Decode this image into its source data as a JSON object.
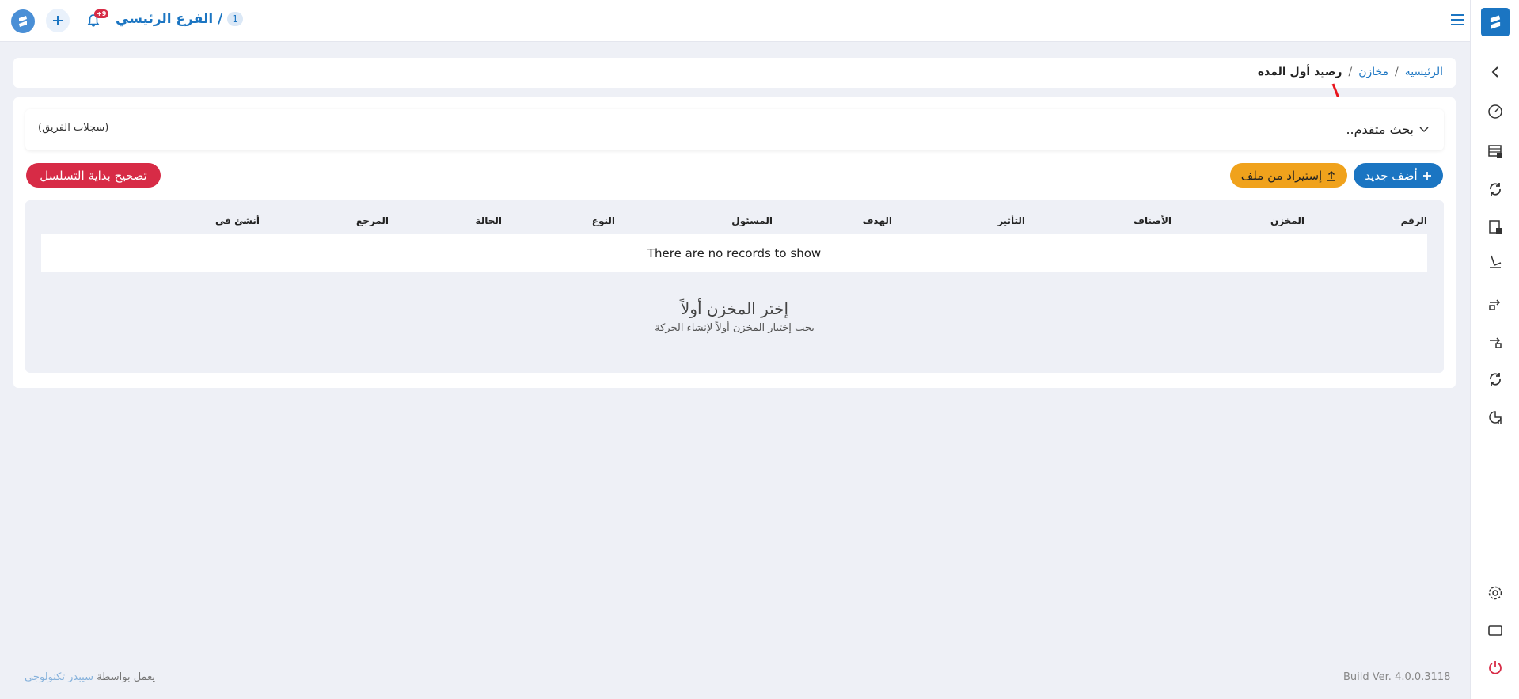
{
  "topbar": {
    "branch_name": "الفرع الرئيسي /",
    "branch_count": "1",
    "notifications_count": "+9",
    "menu_icon": "hamburger-icon"
  },
  "breadcrumb": {
    "home": "الرئيسية",
    "separator": "/",
    "section": "مخازن",
    "current": "رصيد أول المدة"
  },
  "advanced_search": {
    "title": "بحث متقدم..",
    "team_logs": "(سجلات الفريق)"
  },
  "actions": {
    "add_new": "أضف جديد",
    "import_file": "إستيراد من ملف",
    "fix_sequence": "تصحيح بداية التسلسل"
  },
  "table": {
    "columns": [
      "الرقم",
      "المخزن",
      "الأصناف",
      "التأثير",
      "الهدف",
      "المسئول",
      "النوع",
      "الحالة",
      "المرجع",
      "أنشئ فى"
    ],
    "empty_message": "There are no records to show"
  },
  "empty_state": {
    "title": "إختر المخزن أولاً",
    "subtitle": "يجب إختيار المخزن أولاً لإنشاء الحركة"
  },
  "footer": {
    "powered_prefix": "يعمل بواسطة",
    "powered_brand": "سيبدر تكنولوجي",
    "build_version": "Build Ver. 4.0.0.3118"
  },
  "colors": {
    "primary": "#1b75c2",
    "warning": "#f0a21c",
    "danger": "#d72b46",
    "background": "#eef0f6"
  },
  "sidebar_icons": [
    "collapse-chevron-icon",
    "dashboard-gauge-icon",
    "warehouse-icon",
    "sync-icon",
    "stock-document-icon",
    "inventory-adjust-icon",
    "transfer-out-icon",
    "transfer-in-icon",
    "refresh-icon",
    "report-chart-icon",
    "settings-gear-icon",
    "screen-icon",
    "power-icon"
  ]
}
